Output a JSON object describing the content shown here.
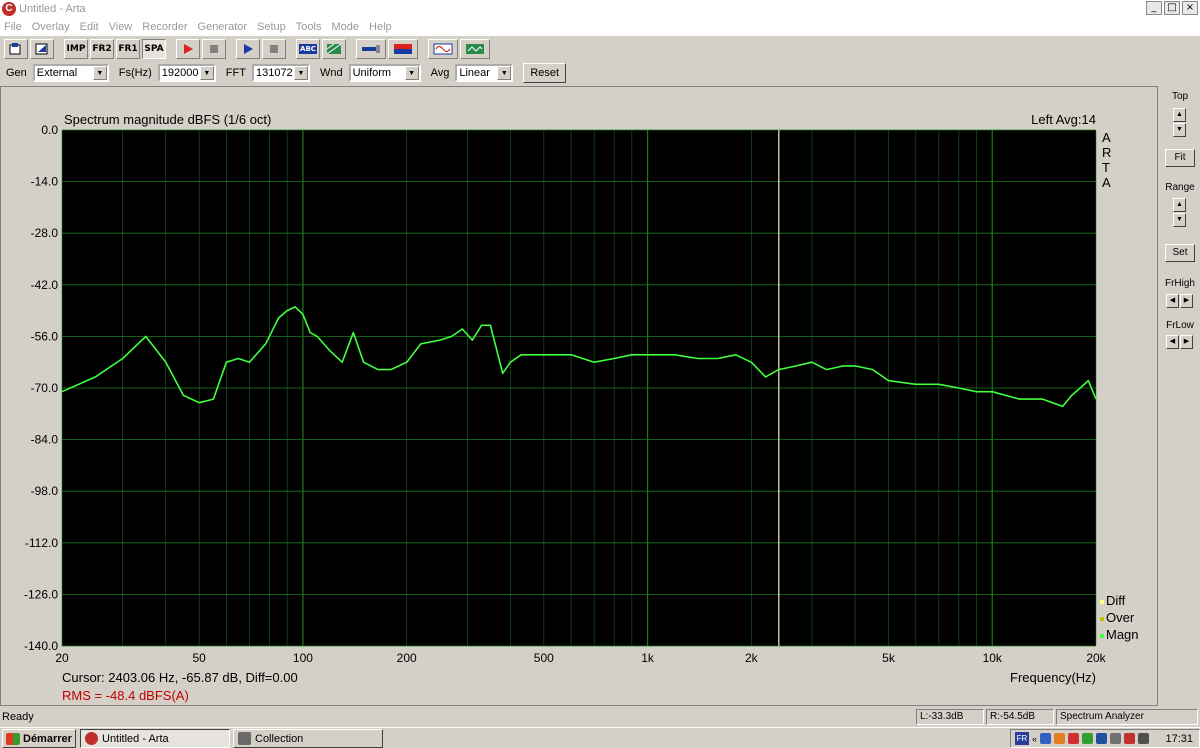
{
  "window": {
    "title": "Untitled - Arta",
    "app_icon_letter": "C"
  },
  "menu": [
    "File",
    "Overlay",
    "Edit",
    "View",
    "Recorder",
    "Generator",
    "Setup",
    "Tools",
    "Mode",
    "Help"
  ],
  "toolbar": {
    "imp": "IMP",
    "fr2": "FR2",
    "fr1": "FR1",
    "spa": "SPA",
    "abc": "ABC"
  },
  "settings": {
    "gen_label": "Gen",
    "gen_value": "External",
    "fs_label": "Fs(Hz)",
    "fs_value": "192000",
    "fft_label": "FFT",
    "fft_value": "131072",
    "wnd_label": "Wnd",
    "wnd_value": "Uniform",
    "avg_label": "Avg",
    "avg_value": "Linear",
    "reset_label": "Reset"
  },
  "side": {
    "top_label": "Top",
    "fit_label": "Fit",
    "range_label": "Range",
    "set_label": "Set",
    "frhigh_label": "FrHigh",
    "frlow_label": "FrLow"
  },
  "status": {
    "ready": "Ready",
    "left_level": "L:-33.3dB",
    "right_level": "R:-54.5dB",
    "mode": "Spectrum Analyzer"
  },
  "taskbar": {
    "start": "Démarrer",
    "task1": "Untitled - Arta",
    "task2": "Collection",
    "lang": "FR",
    "time": "17:31"
  },
  "colors": {
    "plot_bg": "#000000",
    "grid": "#1e7a1e",
    "trace": "#40ff40",
    "cursor": "#f0f0c0",
    "rms": "#c00000"
  },
  "chart_data": {
    "type": "line",
    "title": "Spectrum magnitude dBFS (1/6 oct)",
    "channel_info": "Left  Avg:14",
    "xlabel": "Frequency(Hz)",
    "x_scale": "log",
    "xlim": [
      20,
      20000
    ],
    "ylim": [
      -140,
      0
    ],
    "x_ticks": [
      {
        "v": 20,
        "label": "20"
      },
      {
        "v": 50,
        "label": "50"
      },
      {
        "v": 100,
        "label": "100"
      },
      {
        "v": 200,
        "label": "200"
      },
      {
        "v": 500,
        "label": "500"
      },
      {
        "v": 1000,
        "label": "1k"
      },
      {
        "v": 2000,
        "label": "2k"
      },
      {
        "v": 5000,
        "label": "5k"
      },
      {
        "v": 10000,
        "label": "10k"
      },
      {
        "v": 20000,
        "label": "20k"
      }
    ],
    "y_ticks": [
      {
        "v": 0,
        "label": "0.0"
      },
      {
        "v": -14,
        "label": "-14.0"
      },
      {
        "v": -28,
        "label": "-28.0"
      },
      {
        "v": -42,
        "label": "-42.0"
      },
      {
        "v": -56,
        "label": "-56.0"
      },
      {
        "v": -70,
        "label": "-70.0"
      },
      {
        "v": -84,
        "label": "-84.0"
      },
      {
        "v": -98,
        "label": "-98.0"
      },
      {
        "v": -112,
        "label": "-112.0"
      },
      {
        "v": -126,
        "label": "-126.0"
      },
      {
        "v": -140,
        "label": "-140.0"
      }
    ],
    "right_letters": [
      "A",
      "R",
      "T",
      "A"
    ],
    "legend": [
      {
        "label": "Diff",
        "color": "#ffff80"
      },
      {
        "label": "Over",
        "color": "#c0c000"
      },
      {
        "label": "Magn",
        "color": "#40ff40"
      }
    ],
    "cursor_freq": 2403.06,
    "cursor_text": "Cursor:  2403.06 Hz, -65.87 dB,  Diff=0.00",
    "rms_text": "RMS =  -48.4 dBFS(A)",
    "series": [
      {
        "x": [
          20,
          25,
          30,
          35,
          40,
          45,
          50,
          55,
          60,
          65,
          70,
          78,
          85,
          90,
          95,
          100,
          105,
          110,
          120,
          130,
          140,
          150,
          165,
          180,
          200,
          220,
          250,
          270,
          290,
          310,
          330,
          350,
          380,
          400,
          430,
          500,
          600,
          700,
          800,
          900,
          1000,
          1200,
          1400,
          1600,
          1800,
          2000,
          2200,
          2400,
          2700,
          3000,
          3300,
          3700,
          4000,
          4500,
          5000,
          6000,
          7000,
          8000,
          9000,
          10000,
          12000,
          14000,
          16000,
          17000,
          18000,
          19000,
          20000
        ],
        "y": [
          -71,
          -67,
          -62,
          -56,
          -63,
          -72,
          -74,
          -73,
          -63,
          -62,
          -63,
          -58,
          -51,
          -49,
          -48,
          -50,
          -55,
          -56,
          -60,
          -63,
          -55,
          -63,
          -65,
          -65,
          -63,
          -58,
          -57,
          -56,
          -54,
          -57,
          -53,
          -53,
          -66,
          -63,
          -61,
          -61,
          -61,
          -63,
          -62,
          -61,
          -61,
          -61,
          -62,
          -62,
          -61,
          -63,
          -67,
          -65,
          -64,
          -63,
          -65,
          -64,
          -64,
          -65,
          -68,
          -69,
          -69,
          -70,
          -71,
          -71,
          -73,
          -73,
          -75,
          -72,
          -70,
          -68,
          -73
        ]
      }
    ]
  }
}
